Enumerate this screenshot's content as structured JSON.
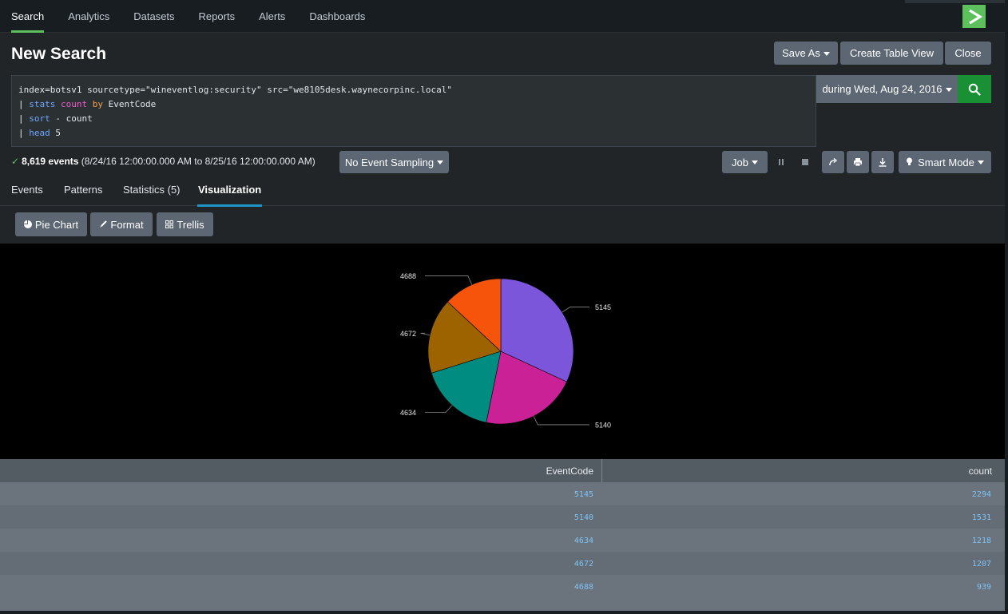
{
  "nav": {
    "tabs": [
      {
        "label": "Search"
      },
      {
        "label": "Analytics"
      },
      {
        "label": "Datasets"
      },
      {
        "label": "Reports"
      },
      {
        "label": "Alerts"
      },
      {
        "label": "Dashboards"
      }
    ],
    "active_tab": "Search",
    "brand_icon": "chevron-right-logo"
  },
  "header": {
    "title": "New Search",
    "save_as_label": "Save As",
    "create_table_view_label": "Create Table View",
    "close_label": "Close"
  },
  "search": {
    "line1": "index=botsv1 sourcetype=\"wineventlog:security\" src=\"we8105desk.waynecorpinc.local\"",
    "line2_pipe": "|",
    "line2_cmd": "stats",
    "line2_fn": "count",
    "line2_by": "by",
    "line2_field": "EventCode",
    "line3_pipe": "|",
    "line3_cmd": "sort",
    "line3_op": "-",
    "line3_field": "count",
    "line4_pipe": "|",
    "line4_cmd": "head",
    "line4_arg": "5",
    "time_range_label": "during Wed, Aug 24, 2016",
    "search_button_icon": "search-icon"
  },
  "status": {
    "event_count": "8,619 events",
    "time_range_text": "(8/24/16 12:00:00.000 AM to 8/25/16 12:00:00.000 AM)",
    "sampling_label": "No Event Sampling",
    "job_label": "Job",
    "mode_label": "Smart Mode"
  },
  "tabs": [
    {
      "label": "Events"
    },
    {
      "label": "Patterns"
    },
    {
      "label": "Statistics (5)"
    },
    {
      "label": "Visualization"
    }
  ],
  "active_tab": "Visualization",
  "viz_toolbar": {
    "pie_chart_label": "Pie Chart",
    "format_label": "Format",
    "trellis_label": "Trellis"
  },
  "chart_data": {
    "type": "pie",
    "categories": [
      "5145",
      "5140",
      "4634",
      "4672",
      "4688"
    ],
    "values": [
      2294,
      1531,
      1218,
      1207,
      939
    ],
    "colors": [
      "#7b56db",
      "#cb2196",
      "#008c80",
      "#9d6300",
      "#f6540b"
    ]
  },
  "table": {
    "columns": [
      "EventCode",
      "count"
    ],
    "rows": [
      [
        "5145",
        "2294"
      ],
      [
        "5140",
        "1531"
      ],
      [
        "4634",
        "1218"
      ],
      [
        "4672",
        "1207"
      ],
      [
        "4688",
        "939"
      ]
    ]
  }
}
